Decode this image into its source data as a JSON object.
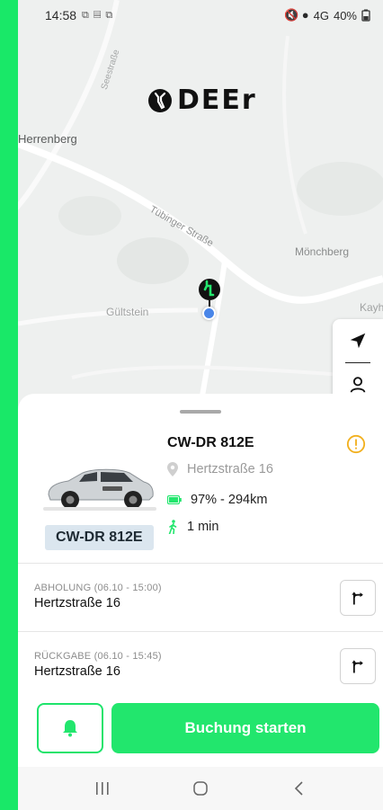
{
  "status_bar": {
    "time": "14:58",
    "notif_icons": "⧉ ▤ ⧉",
    "right_icons": "🔇 ●",
    "network": "4G",
    "battery": "40%"
  },
  "map": {
    "labels": {
      "herrenberg": "Herrenberg",
      "moenchberg": "Mönchberg",
      "gueltstein": "Gültstein",
      "kayh": "Kayh",
      "seestrasse": "Seestraße",
      "tuebinger": "Tübinger Straße"
    },
    "logo_text": "DEEr"
  },
  "vehicle": {
    "plate": "CW-DR 812E",
    "badge": "CW-DR 812E",
    "address": "Hertzstraße 16",
    "battery": "97% - 294km",
    "walk": "1 min"
  },
  "pickup": {
    "label": "ABHOLUNG (06.10 - 15:00)",
    "address": "Hertzstraße 16"
  },
  "return": {
    "label": "RÜCKGABE (06.10 - 15:45)",
    "address": "Hertzstraße 16"
  },
  "actions": {
    "start_label": "Buchung starten"
  },
  "colors": {
    "accent": "#22e66d",
    "warning": "#f2b01e",
    "user_dot": "#4a86e8",
    "badge_bg": "#dbe6ef"
  },
  "icons": {
    "locate": "locate-arrow-icon",
    "profile": "person-icon",
    "warning": "warning-circle-icon",
    "battery": "battery-icon",
    "walk": "walking-person-icon",
    "route": "route-turn-icon",
    "bell": "bell-icon",
    "nav_recent": "recent-apps-icon",
    "nav_home": "home-icon",
    "nav_back": "back-icon"
  }
}
